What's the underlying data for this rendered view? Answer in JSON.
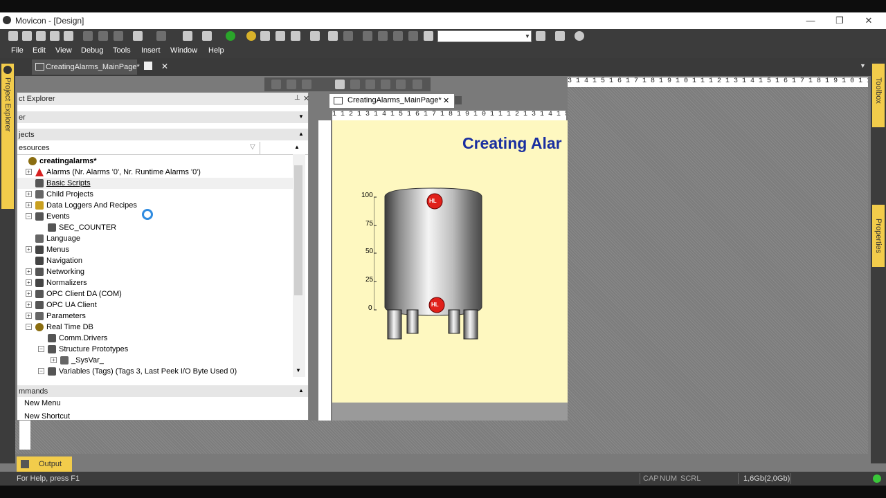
{
  "window": {
    "title": "Movicon - [Design]",
    "min_symbol": "—",
    "restore_symbol": "❐",
    "close_symbol": "✕"
  },
  "menu": [
    "File",
    "Edit",
    "View",
    "Debug",
    "Tools",
    "Insert",
    "Window",
    "Help"
  ],
  "doc_tab": {
    "label": "CreatingAlarms_MainPage*",
    "close": "✕"
  },
  "left_panel": {
    "label": "Project Explorer"
  },
  "right_panel": {
    "toolbox": "Toolbox",
    "properties": "Properties"
  },
  "explorer": {
    "title": "ct Explorer",
    "filter_label": "er",
    "projects_section": "jects",
    "resources_label": "esources",
    "tree": [
      {
        "label": "creatingalarms*",
        "level": 0,
        "expand": "",
        "icon": "gear-icon",
        "bold": true
      },
      {
        "label": "Alarms (Nr. Alarms '0', Nr. Runtime Alarms '0')",
        "level": 1,
        "expand": "+",
        "icon": "alarm-bell-icon"
      },
      {
        "label": "Basic Scripts",
        "level": 1,
        "expand": "",
        "icon": "script-icon",
        "underline": true
      },
      {
        "label": "Child Projects",
        "level": 1,
        "expand": "+",
        "icon": "child-projects-icon"
      },
      {
        "label": "Data Loggers And Recipes",
        "level": 1,
        "expand": "+",
        "icon": "database-icon"
      },
      {
        "label": "Events",
        "level": 1,
        "expand": "−",
        "icon": "events-icon"
      },
      {
        "label": "SEC_COUNTER",
        "level": 2,
        "expand": "",
        "icon": "lightning-icon"
      },
      {
        "label": "Language",
        "level": 1,
        "expand": "",
        "icon": "language-icon"
      },
      {
        "label": "Menus",
        "level": 1,
        "expand": "+",
        "icon": "menu-icon"
      },
      {
        "label": "Navigation",
        "level": 1,
        "expand": "",
        "icon": "navigation-icon"
      },
      {
        "label": "Networking",
        "level": 1,
        "expand": "+",
        "icon": "network-icon"
      },
      {
        "label": "Normalizers",
        "level": 1,
        "expand": "+",
        "icon": "normalizer-icon"
      },
      {
        "label": "OPC Client DA (COM)",
        "level": 1,
        "expand": "+",
        "icon": "opc-icon"
      },
      {
        "label": "OPC UA Client",
        "level": 1,
        "expand": "+",
        "icon": "opc-ua-icon"
      },
      {
        "label": "Parameters",
        "level": 1,
        "expand": "+",
        "icon": "parameters-icon"
      },
      {
        "label": "Real Time DB",
        "level": 1,
        "expand": "−",
        "icon": "gear-icon"
      },
      {
        "label": "Comm.Drivers",
        "level": 2,
        "expand": "",
        "icon": "driver-icon"
      },
      {
        "label": "Structure Prototypes",
        "level": 2,
        "expand": "−",
        "icon": "structure-icon"
      },
      {
        "label": "_SysVar_",
        "level": 3,
        "expand": "+",
        "icon": "struct-item-icon"
      },
      {
        "label": "Variables (Tags) (Tags 3, Last Peek I/O Byte Used 0)",
        "level": 2,
        "expand": "−",
        "icon": "variables-icon"
      }
    ],
    "commands_section": "mmands",
    "commands": [
      "New Menu",
      "New Shortcut"
    ]
  },
  "design": {
    "tab_label": "CreatingAlarms_MainPage*",
    "tab_close": "✕",
    "page_title": "Creating Alar",
    "tank": {
      "scale": [
        "100",
        "75",
        "50",
        "25",
        "0"
      ],
      "high_marker": "HL",
      "low_marker": "HL"
    }
  },
  "output_tab": "Output",
  "status": {
    "help": "For Help, press F1",
    "cap": "CAP",
    "num": "NUM",
    "scrl": "SCRL",
    "memory": "1,6Gb(2,0Gb)"
  },
  "colors": {
    "accent_yellow": "#f2cc4b",
    "canvas_bg": "#fef8c0",
    "title_blue": "#1a2fa0",
    "marker_red": "#e0201a"
  }
}
